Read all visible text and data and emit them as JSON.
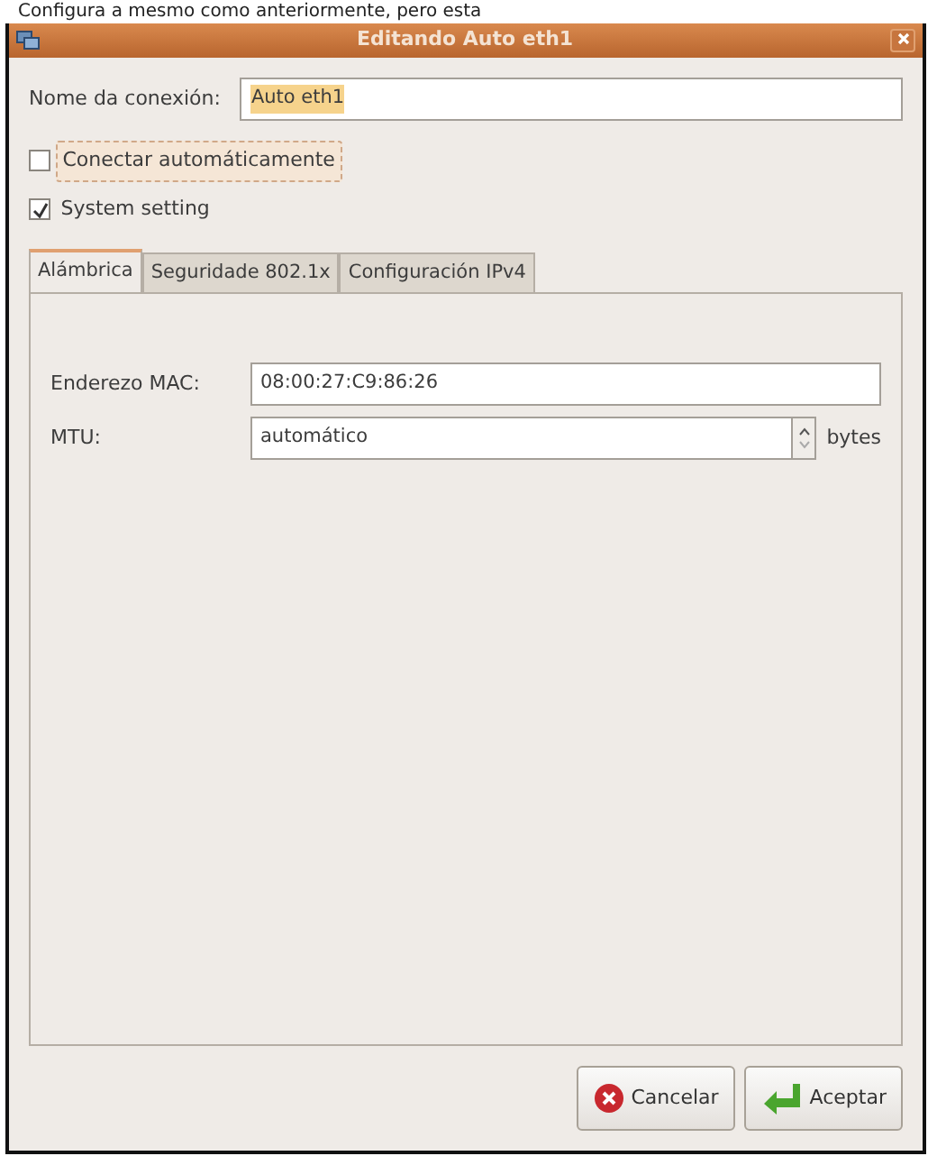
{
  "caption": "Configura a mesmo como anteriormente, pero esta",
  "window": {
    "title": "Editando Auto eth1"
  },
  "connection_name": {
    "label": "Nome da conexión:",
    "value": "Auto eth1"
  },
  "options": [
    {
      "label": "Conectar automáticamente",
      "checked": false,
      "focused": true
    },
    {
      "label": "System setting",
      "checked": true,
      "focused": false
    }
  ],
  "tabs": [
    {
      "label": "Alámbrica",
      "selected": true
    },
    {
      "label": "Seguridade 802.1x",
      "selected": false
    },
    {
      "label": "Configuración IPv4",
      "selected": false
    }
  ],
  "fields": [
    {
      "kind": "text",
      "label": "Enderezo MAC:",
      "value": "08:00:27:C9:86:26"
    },
    {
      "kind": "spin",
      "label": "MTU:",
      "value": "automático",
      "unit": "bytes"
    }
  ],
  "buttons": [
    {
      "kind": "cancel",
      "label": "Cancelar"
    },
    {
      "kind": "ok",
      "label": "Aceptar"
    }
  ]
}
